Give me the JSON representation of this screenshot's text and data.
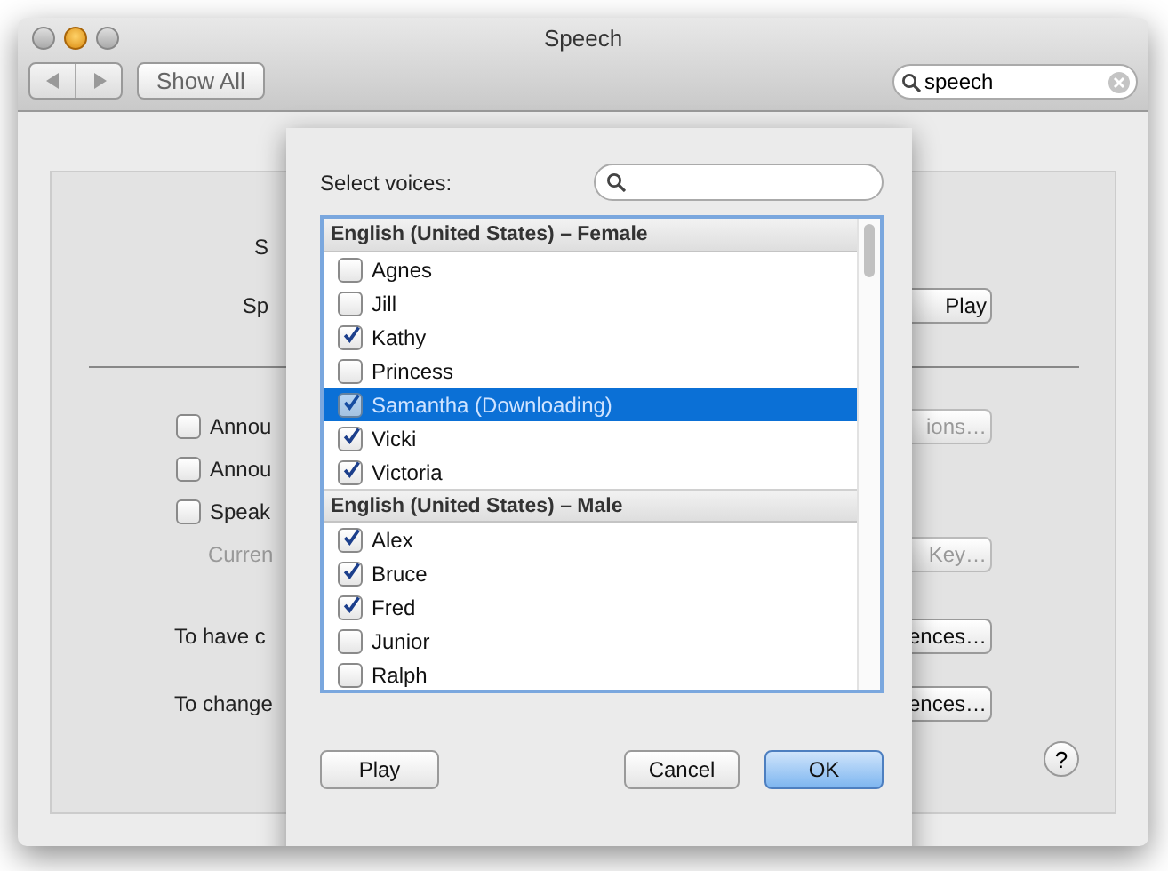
{
  "window": {
    "title": "Speech"
  },
  "toolbar": {
    "show_all": "Show All",
    "search": {
      "value": "speech"
    }
  },
  "background": {
    "rows": [
      {
        "kind": "label",
        "left": "S",
        "button": null
      },
      {
        "kind": "label",
        "left": "Sp",
        "button": "Play"
      },
      {
        "kind": "divider"
      },
      {
        "kind": "checkbox",
        "left": "Annou",
        "checked": false,
        "button": "ions…",
        "disabled": true
      },
      {
        "kind": "checkbox",
        "left": "Annou",
        "checked": false
      },
      {
        "kind": "checkbox",
        "left": "Speak",
        "checked": false
      },
      {
        "kind": "sub",
        "left": "Curren",
        "button": "Key…",
        "disabled": true
      },
      {
        "kind": "label",
        "left": "To have c",
        "button": "ences…",
        "disabled": false
      },
      {
        "kind": "label",
        "left": "To change",
        "button": "ences…",
        "disabled": false
      }
    ],
    "help": "?"
  },
  "sheet": {
    "label": "Select voices:",
    "voices": [
      {
        "kind": "header",
        "label": "English (United States) – Female"
      },
      {
        "kind": "voice",
        "label": "Agnes",
        "checked": false,
        "selected": false
      },
      {
        "kind": "voice",
        "label": "Jill",
        "checked": false,
        "selected": false
      },
      {
        "kind": "voice",
        "label": "Kathy",
        "checked": true,
        "selected": false
      },
      {
        "kind": "voice",
        "label": "Princess",
        "checked": false,
        "selected": false
      },
      {
        "kind": "voice",
        "label": "Samantha (Downloading)",
        "checked": true,
        "selected": true
      },
      {
        "kind": "voice",
        "label": "Vicki",
        "checked": true,
        "selected": false
      },
      {
        "kind": "voice",
        "label": "Victoria",
        "checked": true,
        "selected": false
      },
      {
        "kind": "header",
        "label": "English (United States) – Male"
      },
      {
        "kind": "voice",
        "label": "Alex",
        "checked": true,
        "selected": false
      },
      {
        "kind": "voice",
        "label": "Bruce",
        "checked": true,
        "selected": false
      },
      {
        "kind": "voice",
        "label": "Fred",
        "checked": true,
        "selected": false
      },
      {
        "kind": "voice",
        "label": "Junior",
        "checked": false,
        "selected": false
      },
      {
        "kind": "voice",
        "label": "Ralph",
        "checked": false,
        "selected": false
      }
    ],
    "buttons": [
      {
        "kind": "left",
        "label": "Play"
      },
      {
        "kind": "cancel",
        "label": "Cancel"
      },
      {
        "kind": "default",
        "label": "OK"
      }
    ]
  }
}
